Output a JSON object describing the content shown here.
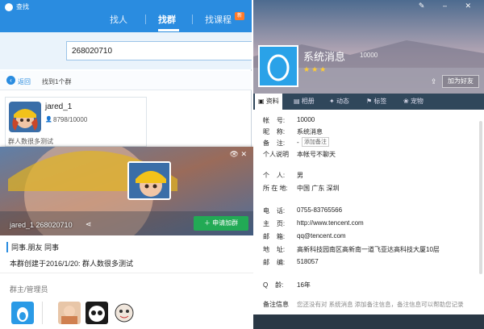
{
  "search_window": {
    "title": "查找",
    "tabs": [
      "找人",
      "找群",
      "找课程"
    ],
    "new_badge": "新",
    "search_value": "268020710",
    "back_label": "返回",
    "result_count_text": "找到1个群",
    "result": {
      "name": "jared_1",
      "members": "8798/10000",
      "description": "群人数很多测试"
    }
  },
  "group_popup": {
    "name_line": "jared_1 268020710",
    "join_label": "申请加群",
    "tags": "同事.朋友  同事",
    "intro": "本群创建于2016/1/20: 群人数很多测试",
    "admins_label": "群主/管理员"
  },
  "profile_window": {
    "name": "系统消息",
    "qq_number": "10000",
    "add_friend_label": "加为好友",
    "tabs": [
      "资料",
      "相册",
      "动态",
      "标签",
      "宠物"
    ],
    "fields": {
      "account_label": "帐    号:",
      "account": "10000",
      "nickname_label": "昵    称:",
      "nickname": "系统消息",
      "memo_label": "备    注:",
      "memo_dash": "-",
      "memo_link": "添加备注",
      "signature_label": "个人说明",
      "signature": "本帐号不聊天",
      "gender_label": "个    人:",
      "gender": "男",
      "location_label": "所 在 地:",
      "location": "中国  广东  深圳",
      "phone_label": "电    话:",
      "phone": "0755-83765566",
      "homepage_label": "主    页:",
      "homepage": "http://www.tencent.com",
      "email_label": "邮    箱:",
      "email": "qq@tencent.com",
      "address_label": "地    址:",
      "address": "高新科技园南区高新南一道飞亚达高科技大厦10层",
      "zip_label": "邮    编:",
      "zip": "518057",
      "qage_label": "Q    龄:",
      "qage": "16年",
      "memo_info_label": "备注信息",
      "memo_info": "您还没有对 系统消息 添加备注信息，备注信息可以帮助您记录"
    }
  }
}
